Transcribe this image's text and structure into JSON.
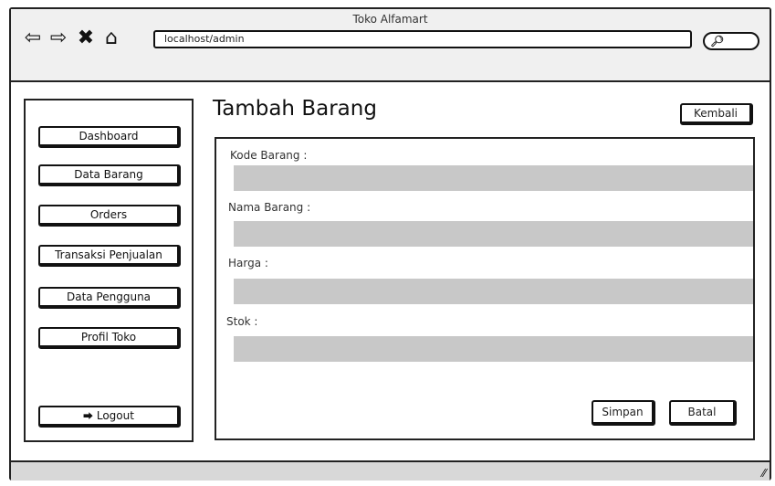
{
  "window": {
    "title": "Toko Alfamart"
  },
  "browser": {
    "url": "localhost/admin",
    "icons": [
      "back-arrow-icon",
      "forward-arrow-icon",
      "close-icon",
      "home-icon",
      "search-icon"
    ]
  },
  "sidebar": {
    "items": [
      {
        "label": "Dashboard"
      },
      {
        "label": "Data Barang"
      },
      {
        "label": "Orders"
      },
      {
        "label": "Transaksi Penjualan"
      },
      {
        "label": "Data Pengguna"
      },
      {
        "label": "Profil Toko"
      }
    ],
    "logout_label": "Logout"
  },
  "main": {
    "title": "Tambah Barang",
    "back_label": "Kembali",
    "fields": [
      {
        "label": "Kode Barang :",
        "value": ""
      },
      {
        "label": "Nama Barang :",
        "value": ""
      },
      {
        "label": "Harga :",
        "value": ""
      },
      {
        "label": "Stok :",
        "value": ""
      }
    ],
    "save_label": "Simpan",
    "cancel_label": "Batal"
  },
  "colors": {
    "input_fill": "#c8c8c8",
    "border": "#222222"
  }
}
